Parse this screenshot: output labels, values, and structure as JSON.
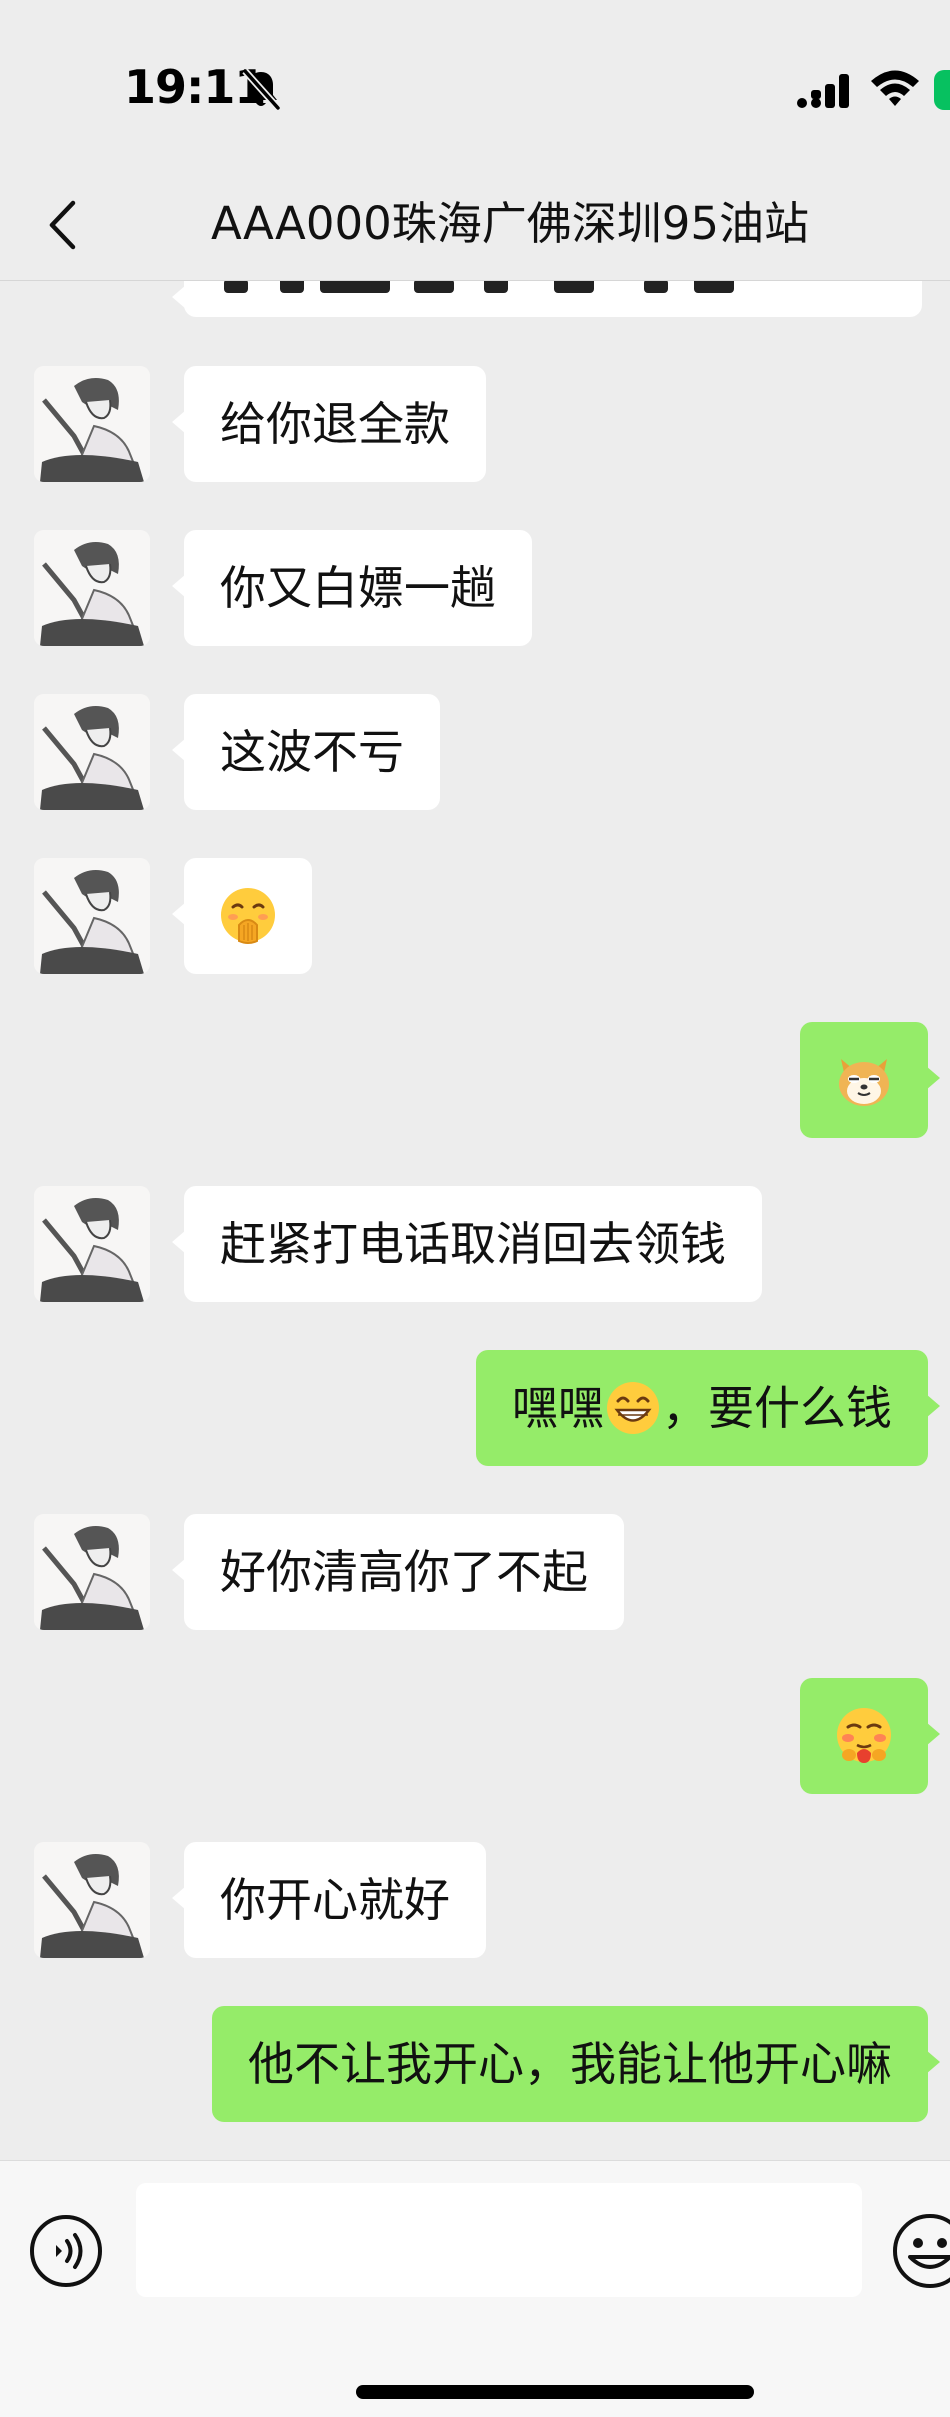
{
  "status_bar": {
    "time": "19:11",
    "icons": [
      "bell-slash-icon",
      "signal-icon",
      "wifi-icon",
      "battery-icon"
    ],
    "battery_color": "#07c160"
  },
  "header": {
    "back_icon": "chevron-left-icon",
    "title": "AAA000珠海广佛深圳95油站"
  },
  "messages": [
    {
      "side": "left",
      "type": "text",
      "text": "给你退全款"
    },
    {
      "side": "left",
      "type": "text",
      "text": "你又白嫖一趟"
    },
    {
      "side": "left",
      "type": "text",
      "text": "这波不亏"
    },
    {
      "side": "left",
      "type": "emoji",
      "emoji": "hand-over-mouth-emoji"
    },
    {
      "side": "right",
      "type": "emoji",
      "emoji": "shiba-dog-face-emoji"
    },
    {
      "side": "left",
      "type": "text",
      "text": "赶紧打电话取消回去领钱"
    },
    {
      "side": "right",
      "type": "text",
      "text_before": "嘿嘿",
      "emoji": "grinning-face-emoji",
      "text_after": "，要什么钱"
    },
    {
      "side": "left",
      "type": "text",
      "text": "好你清高你了不起"
    },
    {
      "side": "right",
      "type": "emoji",
      "emoji": "blushing-hug-emoji"
    },
    {
      "side": "left",
      "type": "text",
      "text": "你开心就好"
    },
    {
      "side": "right",
      "type": "text",
      "text": "他不让我开心，我能让他开心嘛"
    }
  ],
  "input_bar": {
    "voice_icon": "voice-wave-icon",
    "input_value": "",
    "emoji_icon": "smiley-icon"
  },
  "colors": {
    "background": "#ededed",
    "incoming_bubble": "#ffffff",
    "outgoing_bubble": "#95ec69"
  }
}
